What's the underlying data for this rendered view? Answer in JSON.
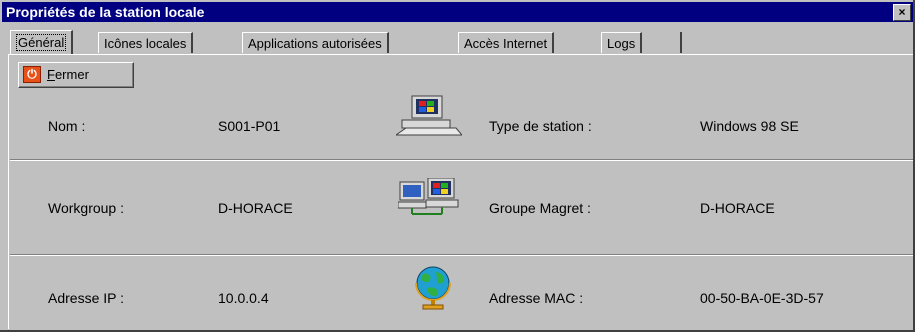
{
  "window": {
    "title": "Propriétés de la station locale",
    "close_label": "×"
  },
  "tabs": [
    {
      "label": "Général",
      "active": true
    },
    {
      "label": "Icônes locales",
      "active": false
    },
    {
      "label": "Applications autorisées",
      "active": false
    },
    {
      "label": "Accès Internet",
      "active": false
    },
    {
      "label": "Logs",
      "active": false
    }
  ],
  "toolbar": {
    "fermer_icon": "power-icon",
    "fermer_prefix": "F",
    "fermer_rest": "ermer"
  },
  "rows": [
    {
      "left_label": "Nom :",
      "left_value": "S001-P01",
      "icon": "computer-icon",
      "right_label": "Type de station :",
      "right_value": "Windows 98 SE"
    },
    {
      "left_label": "Workgroup :",
      "left_value": "D-HORACE",
      "icon": "network-computers-icon",
      "right_label": "Groupe Magret :",
      "right_value": "D-HORACE"
    },
    {
      "left_label": "Adresse IP :",
      "left_value": "10.0.0.4",
      "icon": "globe-icon",
      "right_label": "Adresse MAC :",
      "right_value": "00-50-BA-0E-3D-57"
    }
  ],
  "colors": {
    "titlebar": "#000080",
    "face": "#c0c0c0",
    "power_button": "#e8501a"
  }
}
